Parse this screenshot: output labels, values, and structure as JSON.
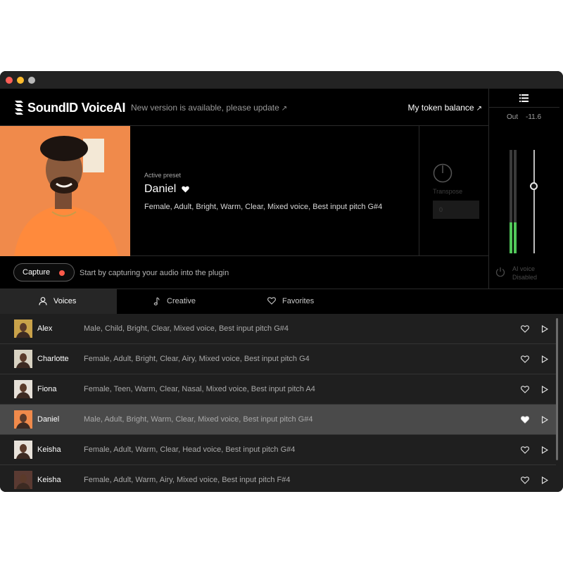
{
  "app": {
    "name": "SoundID VoiceAI",
    "update_notice": "New version is available, please update",
    "token_balance": "My token balance"
  },
  "meter": {
    "out_label": "Out",
    "out_value": "-11.6",
    "left_level": 0.3,
    "right_level": 0.3,
    "output_slider_level": 0.65
  },
  "preset": {
    "active_label": "Active preset",
    "name": "Daniel",
    "favorited": true,
    "description": "Female, Adult, Bright, Warm, Clear, Mixed voice, Best input pitch  G#4",
    "transpose_label": "Transpose",
    "transpose_value": "0"
  },
  "capture": {
    "button_label": "Capture",
    "hint": "Start by capturing your audio into the plugin"
  },
  "ai_voice": {
    "line1": "AI voice",
    "line2": "Disabled"
  },
  "tabs": [
    {
      "label": "Voices",
      "icon": "person-icon",
      "active": true
    },
    {
      "label": "Creative",
      "icon": "music-note-icon",
      "active": false
    },
    {
      "label": "Favorites",
      "icon": "heart-icon",
      "active": false
    }
  ],
  "voices": [
    {
      "name": "Alex",
      "description": "Male, Child, Bright, Clear, Mixed voice, Best input pitch G#4",
      "favorited": false,
      "selected": false,
      "avatar_color": "#c9a24a"
    },
    {
      "name": "Charlotte",
      "description": "Female, Adult, Bright, Clear, Airy, Mixed voice, Best input pitch  G4",
      "favorited": false,
      "selected": false,
      "avatar_color": "#d8d2c2"
    },
    {
      "name": "Fiona",
      "description": "Female, Teen, Warm, Clear, Nasal, Mixed voice, Best input pitch  A4",
      "favorited": false,
      "selected": false,
      "avatar_color": "#e6e0d8"
    },
    {
      "name": "Daniel",
      "description": "Male, Adult, Bright, Warm, Clear, Mixed voice, Best input pitch  G#4",
      "favorited": true,
      "selected": true,
      "avatar_color": "#f08a4b"
    },
    {
      "name": "Keisha",
      "description": "Female, Adult, Warm, Clear, Head voice, Best input pitch  G#4",
      "favorited": false,
      "selected": false,
      "avatar_color": "#e8e2da"
    },
    {
      "name": "Keisha",
      "description": "Female, Adult, Warm, Airy, Mixed voice, Best input pitch  F#4",
      "favorited": false,
      "selected": false,
      "avatar_color": "#5a3a32"
    }
  ],
  "colors": {
    "accent_orange": "#f08a4b",
    "meter_green": "#52c85a",
    "record_red": "#ff5a4a"
  }
}
